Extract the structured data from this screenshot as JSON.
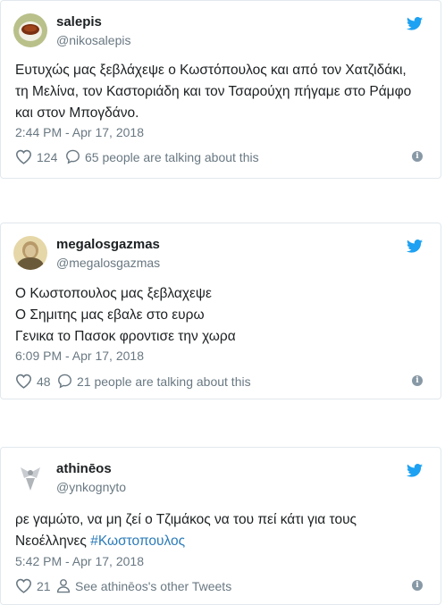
{
  "tweets": [
    {
      "name": "salepis",
      "handle": "@nikosalepis",
      "avatar_icon": "tea-cup-avatar",
      "lines": [
        "Ευτυχώς μας ξεβλάχεψε ο Κωστόπουλος και από τον Χατζιδάκι,",
        "τη Μελίνα, τον Καστοριάδη και τον Τσαρούχη πήγαμε στο Ράμφο",
        "και στον Μπογδάνο."
      ],
      "timestamp": "2:44 PM - Apr 17, 2018",
      "likes": "124",
      "talking": "65 people are talking about this"
    },
    {
      "name": "megalosgazmas",
      "handle": "@megalosgazmas",
      "avatar_icon": "portrait-avatar",
      "lines": [
        "Ο Κωστοπουλος μας ξεβλαχεψε",
        "Ο Σημιτης μας εβαλε στο ευρω",
        "Γενικα το Πασοκ φροντισε την χωρα"
      ],
      "timestamp": "6:09 PM - Apr 17, 2018",
      "likes": "48",
      "talking": "21 people are talking about this"
    },
    {
      "name": "athinēos",
      "handle": "@ynkognyto",
      "avatar_icon": "statue-avatar",
      "line1": "ρε γαμώτο, να μη ζεί ο Τζιμάκος να του πεί κάτι για τους",
      "line2_text": "Νεοέλληνες",
      "hashtag": "#Κωστοπουλος",
      "timestamp": "5:42 PM - Apr 17, 2018",
      "likes": "21",
      "other_tweets": "See athinēos's other Tweets"
    }
  ],
  "icons": {
    "brand": "twitter-bird-icon",
    "like": "heart-icon",
    "reply": "speech-bubble-icon",
    "profile": "person-icon",
    "info": "info-icon"
  },
  "info_glyph": "i",
  "colors": {
    "twitter_blue": "#1da1f2",
    "muted": "#697882",
    "text": "#1c2022",
    "hashtag": "#2b7bb9",
    "border": "#e1e8ed"
  }
}
